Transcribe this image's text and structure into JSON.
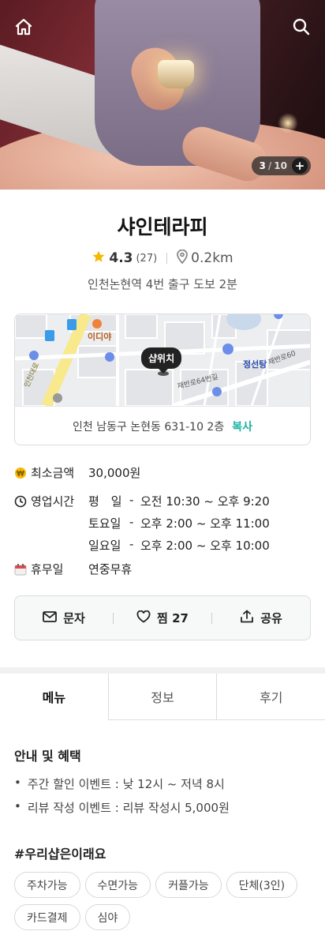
{
  "hero": {
    "counter_current": "3",
    "counter_sep": "/",
    "counter_total": "10",
    "counter_plus": "+"
  },
  "shop": {
    "name": "샤인테라피",
    "rating": "4.3",
    "review_count": "(27)",
    "distance": "0.2km",
    "subway": "인천논현역 4번 출구 도보 2분"
  },
  "map": {
    "pin_label": "샵위치",
    "labels": {
      "ediya": "이디야",
      "jeongseon": "정선탕",
      "road1": "재반로64번길",
      "road2": "재반로60",
      "road3": "인천대로"
    },
    "address": "인천 남동구 논현동 631-10 2층",
    "copy_label": "복사"
  },
  "info": {
    "min_price_label": "최소금액",
    "min_price_value": "30,000원",
    "hours_label": "영업시간",
    "hours": [
      {
        "day": "평　일",
        "dash": "-",
        "time": "오전 10:30 ~ 오후 9:20"
      },
      {
        "day": "토요일",
        "dash": "-",
        "time": "오후 2:00 ~ 오후 11:00"
      },
      {
        "day": "일요일",
        "dash": "-",
        "time": "오후 2:00 ~ 오후 10:00"
      }
    ],
    "closed_label": "휴무일",
    "closed_value": "연중무휴"
  },
  "actions": {
    "message": "문자",
    "like": "찜 27",
    "share": "공유"
  },
  "tabs": [
    "메뉴",
    "정보",
    "후기"
  ],
  "benefits": {
    "title": "안내 및 혜택",
    "items": [
      "주간 할인 이벤트 : 낮 12시 ~ 저녁 8시",
      "리뷰 작성 이벤트 : 리뷰 작성시 5,000원"
    ]
  },
  "tags": {
    "title": "#우리샵은이래요",
    "items": [
      "주차가능",
      "수면가능",
      "커플가능",
      "단체(3인)",
      "카드결제",
      "심야"
    ]
  },
  "colors": {
    "accent": "#17b3a3",
    "star": "#f5b800"
  }
}
